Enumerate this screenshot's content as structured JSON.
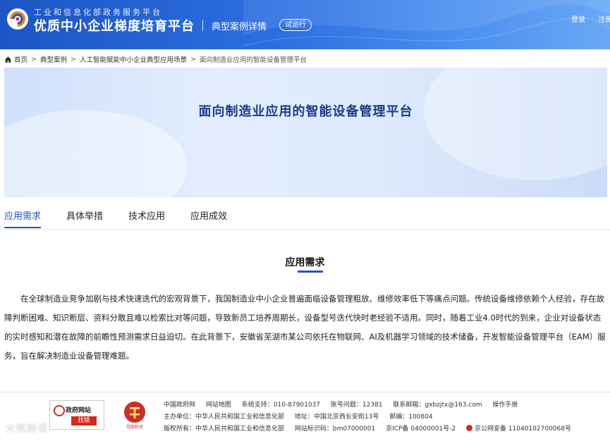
{
  "header": {
    "ministry": "工业和信息化部政务服务平台",
    "site_title": "优质中小企业梯度培育平台",
    "page_label": "典型案例详情",
    "beta_badge": "试运行",
    "login": "登录",
    "register": "注册"
  },
  "breadcrumb": {
    "home": "首页",
    "items": [
      "典型案例",
      "人工智能赋能中小企业典型应用场景",
      "面向制造业应用的智能设备管理平台"
    ]
  },
  "banner": {
    "title": "面向制造业应用的智能设备管理平台"
  },
  "tabs": [
    "应用需求",
    "具体举措",
    "技术应用",
    "应用成效"
  ],
  "section": {
    "heading": "应用需求",
    "body": "在全球制造业竞争加剧与技术快速迭代的宏观背景下，我国制造业中小企业普遍面临设备管理粗放、维修效率低下等痛点问题。传统设备维修依赖个人经验，存在故障判断困难、知识断层、资料分散且难以检索比对等问题，导致新员工培养周期长，设备型号迭代快时老经验不适用。同时，随着工业4.0时代的到来，企业对设备状态的实时感知和潜在故障的前瞻性预测需求日益迫切。在此背景下，安徽省芜湖市某公司依托在物联网、AI及机器学习领域的技术储备，开发智能设备管理平台（EAM）服务，旨在解决制造业设备管理难题。"
  },
  "footer": {
    "gov_badge_top": "政府网站",
    "gov_badge_bottom": "找错",
    "party_label": "党政机关",
    "line1": [
      "中国政府网",
      "网站地图",
      "系统支持：010-87901037",
      "账号问题：12381",
      "联系邮箱：gxbzjtx@163.com",
      "操作手册"
    ],
    "line2": [
      "主办单位：中华人民共和国工业和信息化部",
      "地址：中国北京西长安街13号",
      "邮编：100804"
    ],
    "line3": [
      "版权所有：中华人民共和国工业和信息化部",
      "网站标识码：bm07000001",
      "京ICP备 04000001号-2",
      "京公网安备 11040102700068号"
    ]
  },
  "watermark": "大数跨境",
  "colors": {
    "brand_blue": "#1d56c4",
    "banner_title": "#1b3a8a",
    "badge_red": "#d6281e"
  }
}
